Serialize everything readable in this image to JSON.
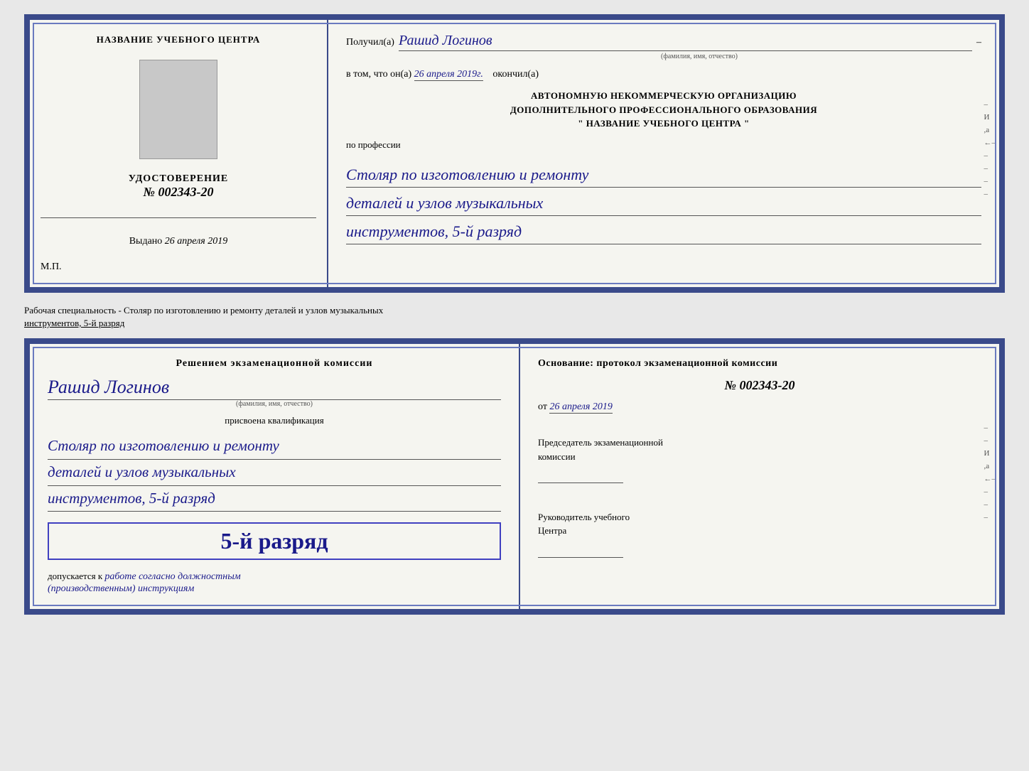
{
  "top_document": {
    "left": {
      "title": "НАЗВАНИЕ УЧЕБНОГО ЦЕНТРА",
      "udostoverenie_label": "УДОСТОВЕРЕНИЕ",
      "number": "№ 002343-20",
      "vydano_label": "Выдано",
      "vydano_date": "26 апреля 2019",
      "mp_label": "М.П."
    },
    "right": {
      "poluchil_label": "Получил(а)",
      "recipient_name": "Рашид Логинов",
      "fio_label": "(фамилия, имя, отчество)",
      "vtom_label": "в том, что он(а)",
      "date_completed": "26 апреля 2019г.",
      "okonchil_label": "окончил(а)",
      "org_line1": "АВТОНОМНУЮ НЕКОММЕРЧЕСКУЮ ОРГАНИЗАЦИЮ",
      "org_line2": "ДОПОЛНИТЕЛЬНОГО ПРОФЕССИОНАЛЬНОГО ОБРАЗОВАНИЯ",
      "org_line3": "\"  НАЗВАНИЕ УЧЕБНОГО ЦЕНТРА  \"",
      "po_professii_label": "по профессии",
      "profession_line1": "Столяр по изготовлению и ремонту",
      "profession_line2": "деталей и узлов музыкальных",
      "profession_line3": "инструментов, 5-й разряд"
    }
  },
  "separator": {
    "text": "Рабочая специальность - Столяр по изготовлению и ремонту деталей и узлов музыкальных",
    "text2": "инструментов, 5-й разряд"
  },
  "bottom_document": {
    "left": {
      "resheniem_label": "Решением экзаменационной комиссии",
      "recipient_name": "Рашид Логинов",
      "fio_label": "(фамилия, имя, отчество)",
      "prisvoena_label": "присвоена квалификация",
      "qual_line1": "Столяр по изготовлению и ремонту",
      "qual_line2": "деталей и узлов музыкальных",
      "qual_line3": "инструментов, 5-й разряд",
      "rank_label": "5-й разряд",
      "dopuskaetsya_label": "допускается к",
      "dopuskaetsya_text": "работе согласно должностным",
      "dopuskaetsya_text2": "(производственным) инструкциям"
    },
    "right": {
      "osnovanie_label": "Основание: протокол экзаменационной комиссии",
      "number": "№ 002343-20",
      "ot_label": "от",
      "date": "26 апреля 2019",
      "predsedatel_line1": "Председатель экзаменационной",
      "predsedatel_line2": "комиссии",
      "rukovoditel_line1": "Руководитель учебного",
      "rukovoditel_line2": "Центра"
    }
  }
}
